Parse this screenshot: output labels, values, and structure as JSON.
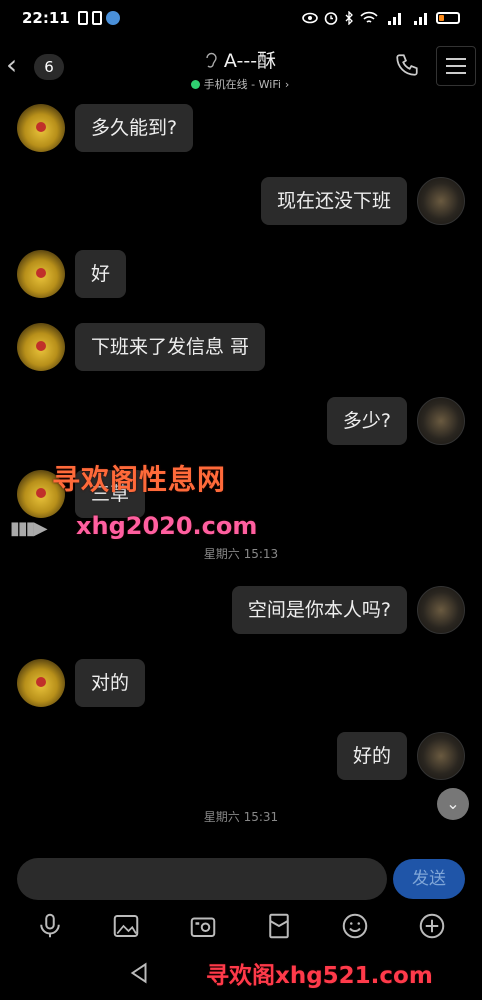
{
  "status_bar": {
    "time": "22:11"
  },
  "header": {
    "back_icon": "chevron-left-icon",
    "unread_count": "6",
    "contact_name": "A---酥",
    "presence": "手机在线 - WiFi",
    "presence_arrow": "›"
  },
  "messages": [
    {
      "side": "left",
      "text": "多久能到?"
    },
    {
      "side": "right",
      "text": "现在还没下班"
    },
    {
      "side": "left",
      "text": "好"
    },
    {
      "side": "left",
      "text": "下班来了发信息 哥"
    },
    {
      "side": "right",
      "text": "多少?"
    },
    {
      "side": "left",
      "text": "三草"
    },
    {
      "side": "right",
      "text": "空间是你本人吗?"
    },
    {
      "side": "left",
      "text": "对的"
    },
    {
      "side": "right",
      "text": "好的"
    }
  ],
  "timestamps": [
    "星期六 15:13",
    "星期六 15:31"
  ],
  "watermarks": {
    "line1": "寻欢阁性息网",
    "line2": "xhg2020.com",
    "arrows": "▮▮▮▶",
    "bottom": "寻欢阁xhg521.com"
  },
  "input": {
    "send_label": "发送"
  },
  "colors": {
    "background": "#000000",
    "bubble": "#2b2b2b",
    "send_button": "#1f55a8",
    "online": "#2fd070"
  }
}
